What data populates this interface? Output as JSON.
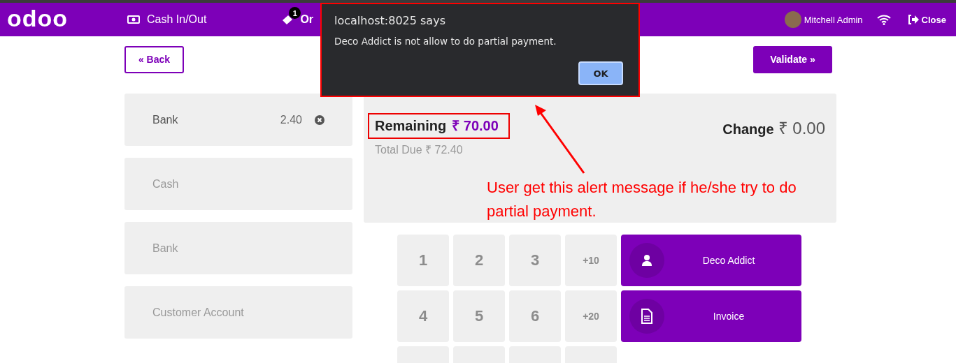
{
  "header": {
    "logo": "odoo",
    "cash_button": "Cash In/Out",
    "orders_button": "Or",
    "orders_badge": "1",
    "user": "Mitchell Admin",
    "close_button": "Close"
  },
  "actions": {
    "back": "« Back",
    "validate": "Validate »"
  },
  "payment_lines": [
    {
      "kind": "line",
      "name": "Bank",
      "amount": "2.40",
      "selected": true
    },
    {
      "kind": "method",
      "name": "Cash",
      "selected": false
    },
    {
      "kind": "method",
      "name": "Bank",
      "selected": false
    },
    {
      "kind": "method",
      "name": "Customer Account",
      "selected": false
    }
  ],
  "summary": {
    "remaining_label": "Remaining",
    "remaining_value": "₹ 70.00",
    "total_due_label": "Total Due",
    "total_due_value": "₹ 72.40",
    "change_label": "Change",
    "change_value": "₹ 0.00"
  },
  "numpad": [
    [
      "1",
      "2",
      "3",
      "+10"
    ],
    [
      "4",
      "5",
      "6",
      "+20"
    ]
  ],
  "side_buttons": [
    {
      "kind": "customer",
      "label": "Deco Addict"
    },
    {
      "kind": "invoice",
      "label": "Invoice"
    }
  ],
  "dialog": {
    "title": "localhost:8025 says",
    "message": "Deco Addict is not allow to do partial payment.",
    "ok": "OK"
  },
  "annotation": {
    "lines": [
      "User get this alert message if he/she try to do",
      "partial payment."
    ]
  }
}
